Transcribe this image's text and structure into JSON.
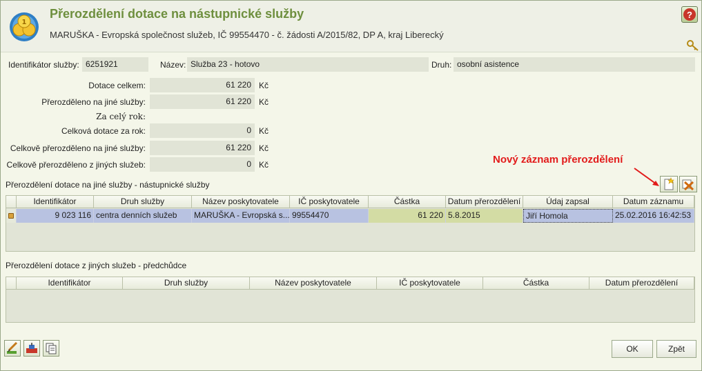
{
  "header": {
    "title": "Přerozdělení dotace na nástupnické služby",
    "subtitle": "MARUŠKA - Evropská společnost služeb, IČ 99554470 - č. žádosti A/2015/82, DP A, kraj Liberecký",
    "help_label": "?"
  },
  "service": {
    "id_label": "Identifikátor služby:",
    "id_value": "6251921",
    "name_label": "Název:",
    "name_value": "Služba 23 - hotovo",
    "kind_label": "Druh:",
    "kind_value": "osobní asistence"
  },
  "summary": {
    "total_label": "Dotace celkem:",
    "total_value": "61 220",
    "redistributed_label": "Přerozděleno na jiné služby:",
    "redistributed_value": "61 220",
    "year_heading": "Za celý rok:",
    "year_total_label": "Celková dotace za rok:",
    "year_total_value": "0",
    "year_redistributed_to_label": "Celkově přerozděleno na jiné služby:",
    "year_redistributed_to_value": "61 220",
    "year_redistributed_from_label": "Celkově přerozděleno z jiných služeb:",
    "year_redistributed_from_value": "0",
    "currency": "Kč"
  },
  "annotation": {
    "text": "Nový záznam přerozdělení",
    "color": "#e21b1b"
  },
  "successors": {
    "title": "Přerozdělení dotace na jiné služby - nástupnické služby",
    "columns": [
      "Identifikátor",
      "Druh služby",
      "Název poskytovatele",
      "IČ poskytovatele",
      "Částka",
      "Datum přerozdělení",
      "Údaj zapsal",
      "Datum záznamu"
    ],
    "rows": [
      {
        "id": "9 023 116",
        "kind": "centra denních služeb",
        "provider": "MARUŠKA - Evropská s...",
        "ico": "99554470",
        "amount": "61 220",
        "date": "5.8.2015",
        "author": "Jiří Homola",
        "record_date": "25.02.2016 16:42:53"
      }
    ]
  },
  "predecessors": {
    "title": "Přerozdělení dotace z jiných služeb - předchůdce",
    "columns": [
      "Identifikátor",
      "Druh služby",
      "Název poskytovatele",
      "IČ poskytovatele",
      "Částka",
      "Datum přerozdělení"
    ]
  },
  "buttons": {
    "ok": "OK",
    "back": "Zpět"
  },
  "icons": {
    "logo": "coins-icon",
    "new_record": "new-record-icon",
    "delete_record": "delete-record-icon",
    "key": "key-icon",
    "edit": "edit-icon",
    "transfer": "transfer-icon",
    "copy": "copy-icon"
  }
}
